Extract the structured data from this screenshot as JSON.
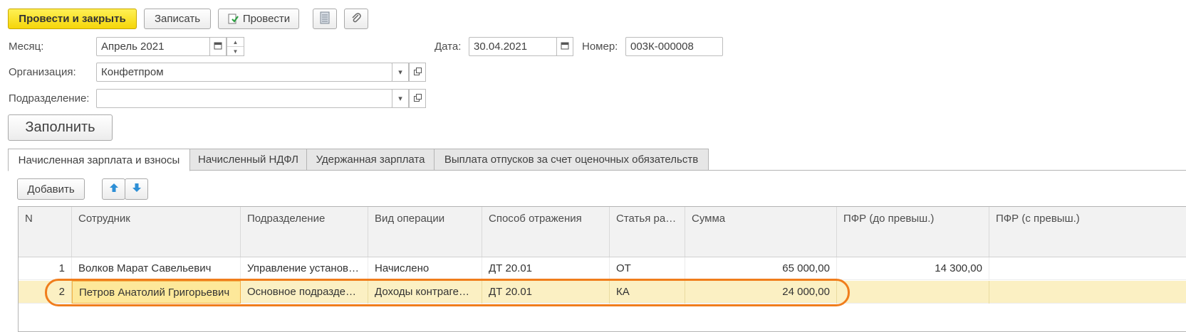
{
  "toolbar": {
    "post_and_close": "Провести и закрыть",
    "save": "Записать",
    "post": "Провести"
  },
  "form": {
    "month_label": "Месяц:",
    "month_value": "Апрель 2021",
    "date_label": "Дата:",
    "date_value": "30.04.2021",
    "number_label": "Номер:",
    "number_value": "003К-000008",
    "org_label": "Организация:",
    "org_value": "Конфетпром",
    "dept_label": "Подразделение:",
    "dept_value": "",
    "fill_button": "Заполнить"
  },
  "tabs": [
    {
      "label": "Начисленная зарплата и взносы",
      "active": true
    },
    {
      "label": "Начисленный НДФЛ",
      "active": false
    },
    {
      "label": "Удержанная зарплата",
      "active": false
    },
    {
      "label": "Выплата отпусков за счет оценочных обязательств",
      "active": false
    }
  ],
  "table_toolbar": {
    "add": "Добавить"
  },
  "table": {
    "columns": [
      "N",
      "Сотрудник",
      "Подразделение",
      "Вид операции",
      "Способ отражения",
      "Статья ра…",
      "Сумма",
      "ПФР (до превыш.)",
      "ПФР (с превыш.)"
    ],
    "rows": [
      {
        "n": "1",
        "employee": "Волков Марат Савельевич",
        "dept": "Управление установ…",
        "operation": "Начислено",
        "method": "ДТ 20.01",
        "item": "ОТ",
        "sum": "65 000,00",
        "pfr_before": "14 300,00",
        "pfr_after": "",
        "selected": false
      },
      {
        "n": "2",
        "employee": "Петров Анатолий Григорьевич",
        "dept": "Основное подразде…",
        "operation": "Доходы контраген…",
        "method": "ДТ 20.01",
        "item": "КА",
        "sum": "24 000,00",
        "pfr_before": "",
        "pfr_after": "",
        "selected": true
      }
    ]
  },
  "colors": {
    "primary_button": "#f5d50a",
    "selected_row": "#fbf0c3",
    "highlight_outline": "#f07d1c",
    "arrow_blue": "#2d8fd6"
  },
  "icons": [
    "report-icon",
    "paperclip-icon",
    "post-document-icon",
    "calendar-icon",
    "dropdown-icon",
    "open-icon",
    "arrow-up-icon",
    "arrow-down-icon"
  ]
}
